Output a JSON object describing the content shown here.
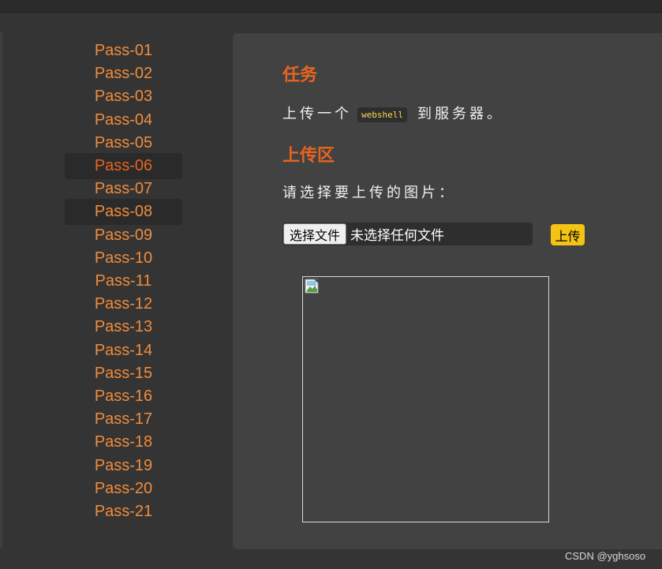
{
  "sidebar": {
    "items": [
      {
        "label": "Pass-01"
      },
      {
        "label": "Pass-02"
      },
      {
        "label": "Pass-03"
      },
      {
        "label": "Pass-04"
      },
      {
        "label": "Pass-05"
      },
      {
        "label": "Pass-06"
      },
      {
        "label": "Pass-07"
      },
      {
        "label": "Pass-08"
      },
      {
        "label": "Pass-09"
      },
      {
        "label": "Pass-10"
      },
      {
        "label": "Pass-11"
      },
      {
        "label": "Pass-12"
      },
      {
        "label": "Pass-13"
      },
      {
        "label": "Pass-14"
      },
      {
        "label": "Pass-15"
      },
      {
        "label": "Pass-16"
      },
      {
        "label": "Pass-17"
      },
      {
        "label": "Pass-18"
      },
      {
        "label": "Pass-19"
      },
      {
        "label": "Pass-20"
      },
      {
        "label": "Pass-21"
      }
    ],
    "active_label": "Pass-06"
  },
  "task": {
    "title": "任务",
    "text_before": "上传一个",
    "code": "webshell",
    "text_after": "到服务器。"
  },
  "upload": {
    "title": "上传区",
    "prompt": "请选择要上传的图片：",
    "file_button_label": "选择文件",
    "file_status": "未选择任何文件",
    "submit_label": "上传"
  },
  "preview": {
    "icon": "broken-image-icon"
  },
  "watermark": "CSDN @yghsoso",
  "colors": {
    "accent": "#f08c3c",
    "active": "#e8641e",
    "upload_button": "#f5c314",
    "code_text": "#ffd84a"
  }
}
